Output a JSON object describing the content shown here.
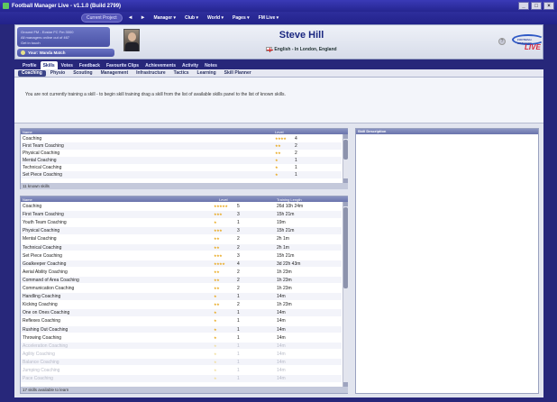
{
  "window": {
    "title": "Football Manager Live - v1.1.0 (Build 2799)",
    "controls": [
      "_",
      "□",
      "×"
    ]
  },
  "menubar": {
    "current_pill": "Current Project",
    "back": "◄",
    "forward": "►",
    "menus": [
      "Manager ▾",
      "Club ▾",
      "World ▾",
      "Pages ▾",
      "FM Live ▾"
    ]
  },
  "header": {
    "next_match_lines": [
      "Ground FM - Ecstar FC Fm 3000",
      "All managers online out of 467",
      "Get in touch"
    ],
    "your_fixtures": "Your: Wanda Match",
    "manager_name": "Steve Hill",
    "manager_detail": "English - In London, England",
    "help": "?",
    "logo_top": "FOOTBALL MANAGER",
    "logo_bottom": "LIVE"
  },
  "tabs": [
    {
      "label": "Profile",
      "active": false
    },
    {
      "label": "Skills",
      "active": true
    },
    {
      "label": "Votes",
      "active": false
    },
    {
      "label": "Feedback",
      "active": false
    },
    {
      "label": "Favourite Clips",
      "active": false
    },
    {
      "label": "Achievements",
      "active": false
    },
    {
      "label": "Activity",
      "active": false
    },
    {
      "label": "Notes",
      "active": false
    }
  ],
  "subtabs": [
    {
      "label": "Coaching",
      "active": true
    },
    {
      "label": "Physio",
      "active": false
    },
    {
      "label": "Scouting",
      "active": false
    },
    {
      "label": "Management",
      "active": false
    },
    {
      "label": "Infrastructure",
      "active": false
    },
    {
      "label": "Tactics",
      "active": false
    },
    {
      "label": "Learning",
      "active": false
    },
    {
      "label": "Skill Planner",
      "active": false
    }
  ],
  "info_text": "You are not currently training a skill - to begin skill training drag a skill from the list of available skills panel to the list of known skills.",
  "known_skills": {
    "columns": {
      "name": "Name",
      "level": "Level"
    },
    "rows": [
      {
        "name": "Coaching",
        "stars": "★★★★",
        "level": "4"
      },
      {
        "name": "First Team Coaching",
        "stars": "★★",
        "level": "2"
      },
      {
        "name": "Physical Coaching",
        "stars": "★★",
        "level": "2"
      },
      {
        "name": "Mental Coaching",
        "stars": "★",
        "level": "1"
      },
      {
        "name": "Technical Coaching",
        "stars": "★",
        "level": "1"
      },
      {
        "name": "Set Piece Coaching",
        "stars": "★",
        "level": "1"
      }
    ],
    "footer": "11 known skills"
  },
  "available_skills": {
    "columns": {
      "name": "Name",
      "level": "Level",
      "time": "Training Length"
    },
    "rows": [
      {
        "name": "Coaching",
        "stars": "★★★★★",
        "level": "5",
        "time": "26d 10h 24m",
        "faded": false
      },
      {
        "name": "First Team Coaching",
        "stars": "★★★",
        "level": "3",
        "time": "15h 21m",
        "faded": false
      },
      {
        "name": "Youth Team Coaching",
        "stars": "★",
        "level": "1",
        "time": "19m",
        "faded": false
      },
      {
        "name": "Physical Coaching",
        "stars": "★★★",
        "level": "3",
        "time": "15h 21m",
        "faded": false
      },
      {
        "name": "Mental Coaching",
        "stars": "★★",
        "level": "2",
        "time": "2h 1m",
        "faded": false
      },
      {
        "name": "Technical Coaching",
        "stars": "★★",
        "level": "2",
        "time": "2h 1m",
        "faded": false
      },
      {
        "name": "Set Piece Coaching",
        "stars": "★★★",
        "level": "3",
        "time": "15h 21m",
        "faded": false
      },
      {
        "name": "Goalkeeper Coaching",
        "stars": "★★★★",
        "level": "4",
        "time": "3d 22h 43m",
        "faded": false
      },
      {
        "name": "Aerial Ability Coaching",
        "stars": "★★",
        "level": "2",
        "time": "1h 23m",
        "faded": false
      },
      {
        "name": "Command of Area Coaching",
        "stars": "★★",
        "level": "2",
        "time": "1h 23m",
        "faded": false
      },
      {
        "name": "Communication Coaching",
        "stars": "★★",
        "level": "2",
        "time": "1h 23m",
        "faded": false
      },
      {
        "name": "Handling Coaching",
        "stars": "★",
        "level": "1",
        "time": "14m",
        "faded": false
      },
      {
        "name": "Kicking Coaching",
        "stars": "★★",
        "level": "2",
        "time": "1h 23m",
        "faded": false
      },
      {
        "name": "One on Ones Coaching",
        "stars": "★",
        "level": "1",
        "time": "14m",
        "faded": false
      },
      {
        "name": "Reflexes Coaching",
        "stars": "★",
        "level": "1",
        "time": "14m",
        "faded": false
      },
      {
        "name": "Rushing Out Coaching",
        "stars": "★",
        "level": "1",
        "time": "14m",
        "faded": false
      },
      {
        "name": "Throwing Coaching",
        "stars": "★",
        "level": "1",
        "time": "14m",
        "faded": false
      },
      {
        "name": "Acceleration Coaching",
        "stars": "★",
        "level": "1",
        "time": "14m",
        "faded": true
      },
      {
        "name": "Agility Coaching",
        "stars": "★",
        "level": "1",
        "time": "14m",
        "faded": true
      },
      {
        "name": "Balance Coaching",
        "stars": "★",
        "level": "1",
        "time": "14m",
        "faded": true
      },
      {
        "name": "Jumping Coaching",
        "stars": "★",
        "level": "1",
        "time": "14m",
        "faded": true
      },
      {
        "name": "Pace Coaching",
        "stars": "★",
        "level": "1",
        "time": "14m",
        "faded": true
      }
    ],
    "footer": "17 skills available to learn"
  },
  "skill_description": {
    "title": "Skill Description"
  },
  "colors": {
    "background": "#27277a",
    "active_subtab": "#3b4488",
    "star": "#e8a515"
  }
}
